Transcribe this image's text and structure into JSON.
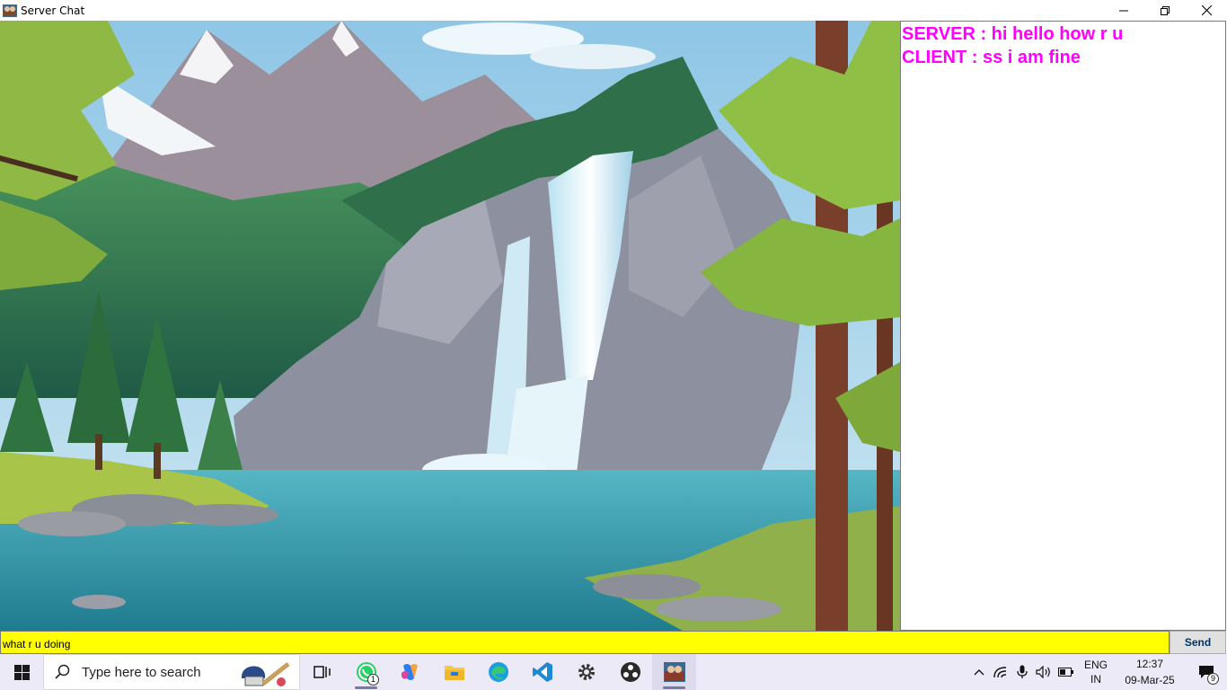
{
  "window": {
    "title": "Server Chat"
  },
  "chat": {
    "messages": [
      "SERVER : hi hello how r u",
      "CLIENT : ss i am fine"
    ],
    "text_color": "#ff00ff"
  },
  "input": {
    "value": "what r u doing",
    "background": "#ffff00"
  },
  "send_button": {
    "label": "Send"
  },
  "taskbar": {
    "search_placeholder": "Type here to search",
    "whatsapp_badge": "1",
    "language_line1": "ENG",
    "language_line2": "IN",
    "time": "12:37",
    "date": "09-Mar-25",
    "notification_count": "9",
    "pinned_icons": [
      "task-view-icon",
      "whatsapp-icon",
      "copilot-icon",
      "file-explorer-icon",
      "edge-icon",
      "vscode-icon",
      "settings-icon",
      "obs-icon",
      "java-app-icon"
    ]
  }
}
